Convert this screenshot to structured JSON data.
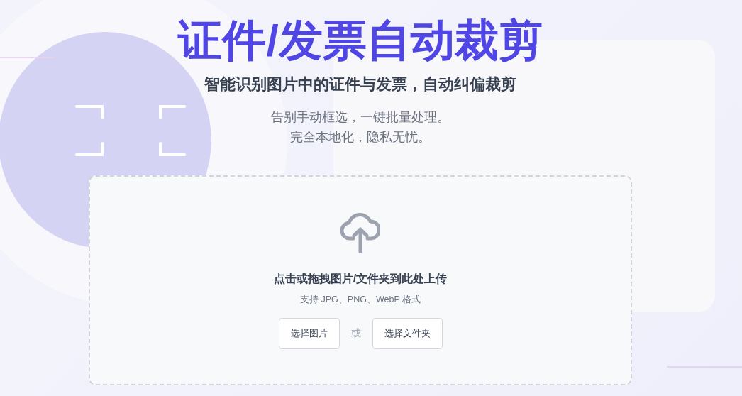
{
  "hero": {
    "title": "证件/发票自动裁剪",
    "subtitle": "智能识别图片中的证件与发票，自动纠偏裁剪",
    "taglines": [
      "告别手动框选，一键批量处理。",
      "完全本地化，隐私无忧。"
    ]
  },
  "dropzone": {
    "prompt": "点击或拖拽图片/文件夹到此处上传",
    "formats": "支持 JPG、PNG、WebP 格式",
    "separator": "或",
    "buttons": [
      "选择图片",
      "选择文件夹"
    ]
  }
}
